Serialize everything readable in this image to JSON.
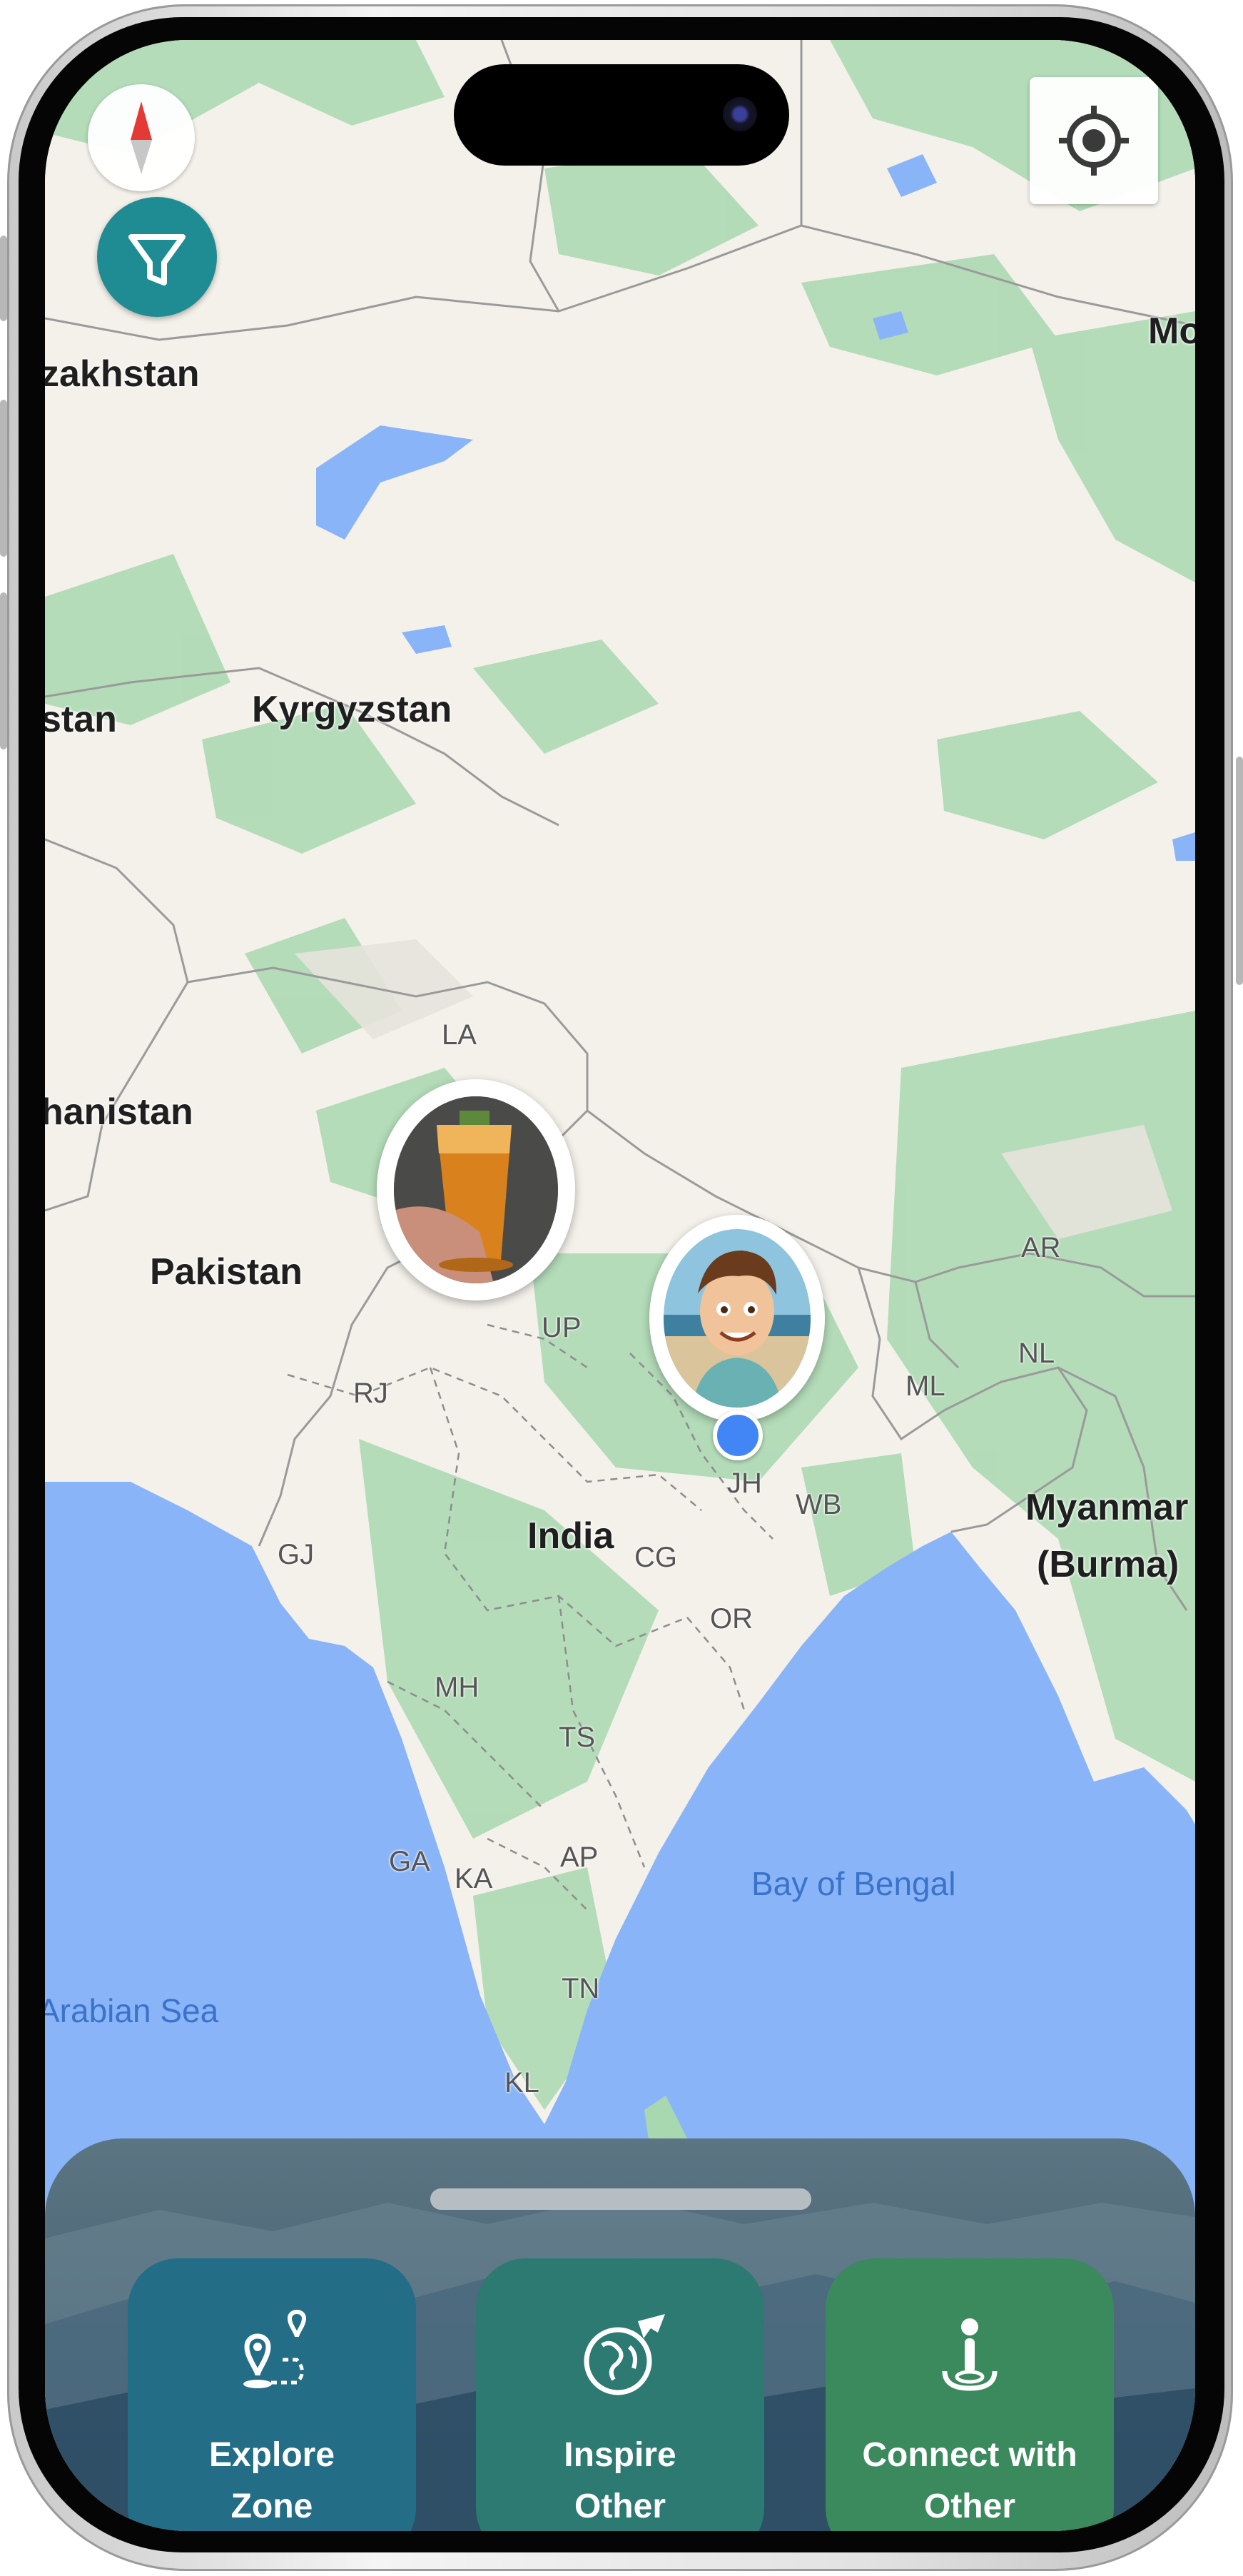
{
  "map": {
    "labels": {
      "kazakhstan": "zakhstan",
      "mongolia": "Mo",
      "kyrgyzstan": "Kyrgyzstan",
      "stan": "stan",
      "afghanistan": "hanistan",
      "pakistan": "Pakistan",
      "india": "India",
      "myanmar_line1": "Myanmar",
      "myanmar_line2": "(Burma)",
      "bay_of_bengal": "Bay of Bengal",
      "arabian_sea": "Arabian Sea",
      "la": "LA",
      "up": "UP",
      "rj": "RJ",
      "gj": "GJ",
      "jh": "JH",
      "wb": "WB",
      "cg": "CG",
      "or": "OR",
      "mh": "MH",
      "ts": "TS",
      "ga": "GA",
      "ka": "KA",
      "ap": "AP",
      "tn": "TN",
      "kl": "KL",
      "ml": "ML",
      "ar": "AR",
      "nl": "NL"
    },
    "colors": {
      "land": "#f4f1ea",
      "vegetation": "#a8d8b0",
      "water": "#8ab4f8",
      "border": "#9a9a9a",
      "user_dot": "#4285f4"
    }
  },
  "controls": {
    "compass_icon": "compass-icon",
    "filter_icon": "filter-icon",
    "locate_icon": "my-location-icon",
    "filter_color": "#1f8c94"
  },
  "markers": [
    {
      "name": "drink-photo-marker",
      "icon": "drink-photo"
    },
    {
      "name": "user-avatar-marker",
      "icon": "cartoon-avatar"
    }
  ],
  "bottom_sheet": {
    "actions": [
      {
        "label": "Explore\nZone",
        "icon": "route-pins-icon",
        "color": "#236e86"
      },
      {
        "label": "Inspire\nOther",
        "icon": "globe-plane-icon",
        "color": "#2c7a72"
      },
      {
        "label": "Connect with\nOther",
        "icon": "person-pin-icon",
        "color": "#3a8a5e"
      }
    ]
  }
}
